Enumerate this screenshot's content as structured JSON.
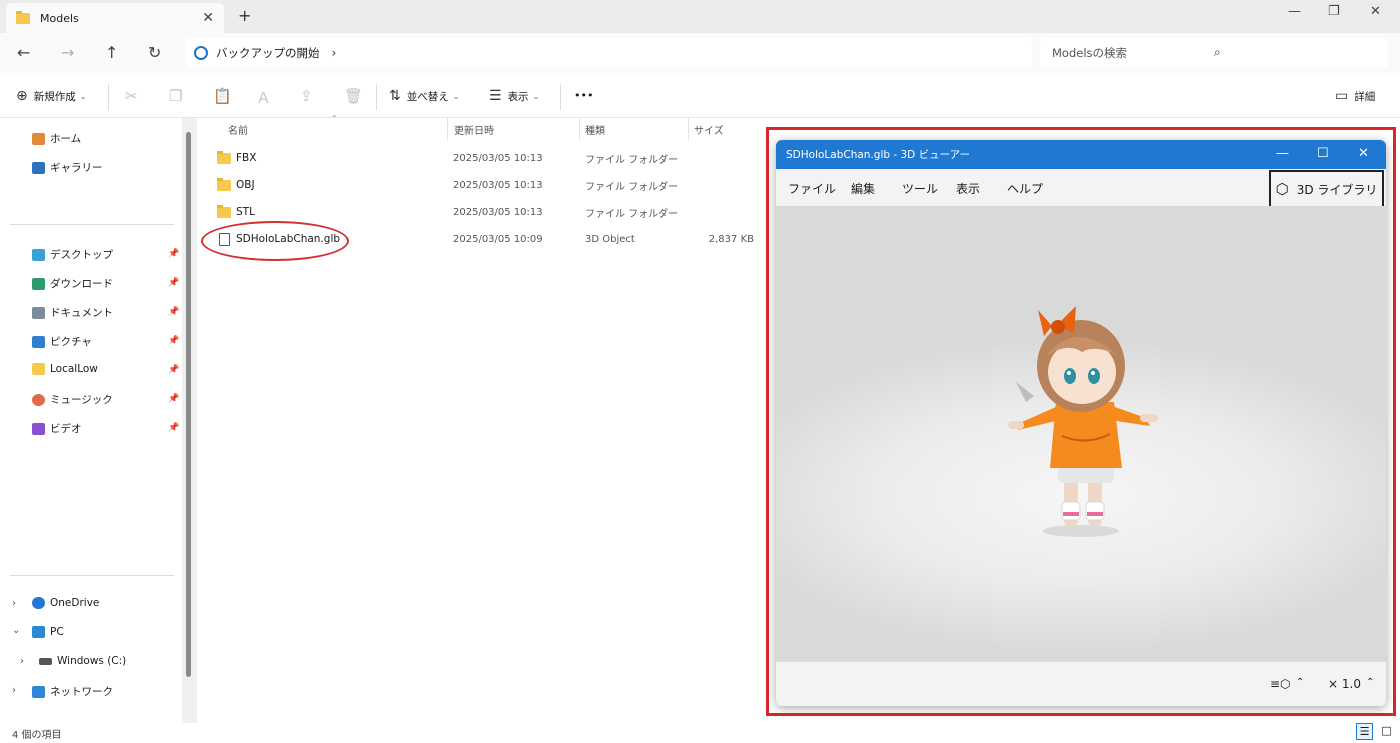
{
  "tab": {
    "title": "Models",
    "close": "✕",
    "new": "+"
  },
  "window_controls": {
    "minimize": "—",
    "restore": "❐",
    "close": "✕"
  },
  "nav": {
    "back": "←",
    "forward": "→",
    "up": "↑",
    "refresh": "↻"
  },
  "address": {
    "crumb": "バックアップの開始",
    "chevron": "›"
  },
  "search": {
    "placeholder": "Modelsの検索"
  },
  "toolbar": {
    "new": "新規作成",
    "sort": "並べ替え",
    "view": "表示",
    "more": "•••",
    "details": "詳細"
  },
  "sidebar": {
    "quick": [
      {
        "label": "ホーム",
        "color": "#e08a3a"
      },
      {
        "label": "ギャラリー",
        "color": "#2e6fbf"
      }
    ],
    "pinned": [
      {
        "label": "デスクトップ",
        "color": "#3aa0d8"
      },
      {
        "label": "ダウンロード",
        "color": "#2c9c6a"
      },
      {
        "label": "ドキュメント",
        "color": "#7a8b9c"
      },
      {
        "label": "ピクチャ",
        "color": "#2f7fd0"
      },
      {
        "label": "LocalLow",
        "color": "#f4c94d"
      },
      {
        "label": "ミュージック",
        "color": "#e06a4a"
      },
      {
        "label": "ビデオ",
        "color": "#8a4fd0"
      }
    ],
    "tree": [
      {
        "label": "OneDrive",
        "color": "#1f78d1",
        "expander": "›"
      },
      {
        "label": "PC",
        "color": "#2e88d8",
        "expander": "⌄"
      },
      {
        "label": "Windows (C:)",
        "color": "#555555",
        "expander": "›"
      },
      {
        "label": "ネットワーク",
        "color": "#2e88d8",
        "expander": "›"
      }
    ]
  },
  "columns": {
    "name": "名前",
    "date": "更新日時",
    "type": "種類",
    "size": "サイズ"
  },
  "files": [
    {
      "name": "FBX",
      "date": "2025/03/05 10:13",
      "type": "ファイル フォルダー",
      "size": ""
    },
    {
      "name": "OBJ",
      "date": "2025/03/05 10:13",
      "type": "ファイル フォルダー",
      "size": ""
    },
    {
      "name": "STL",
      "date": "2025/03/05 10:13",
      "type": "ファイル フォルダー",
      "size": ""
    },
    {
      "name": "SDHoloLabChan.glb",
      "date": "2025/03/05 10:09",
      "type": "3D Object",
      "size": "2,837 KB"
    }
  ],
  "status": {
    "count": "4 個の項目"
  },
  "viewer": {
    "title": "SDHoloLabChan.glb - 3D ビューアー",
    "menu": [
      "ファイル",
      "編集",
      "ツール",
      "表示",
      "ヘルプ"
    ],
    "library": "3D ライブラリ",
    "zoom": "× 1.0",
    "accent": "#1f78d1"
  },
  "highlight_color": "#d7272d"
}
